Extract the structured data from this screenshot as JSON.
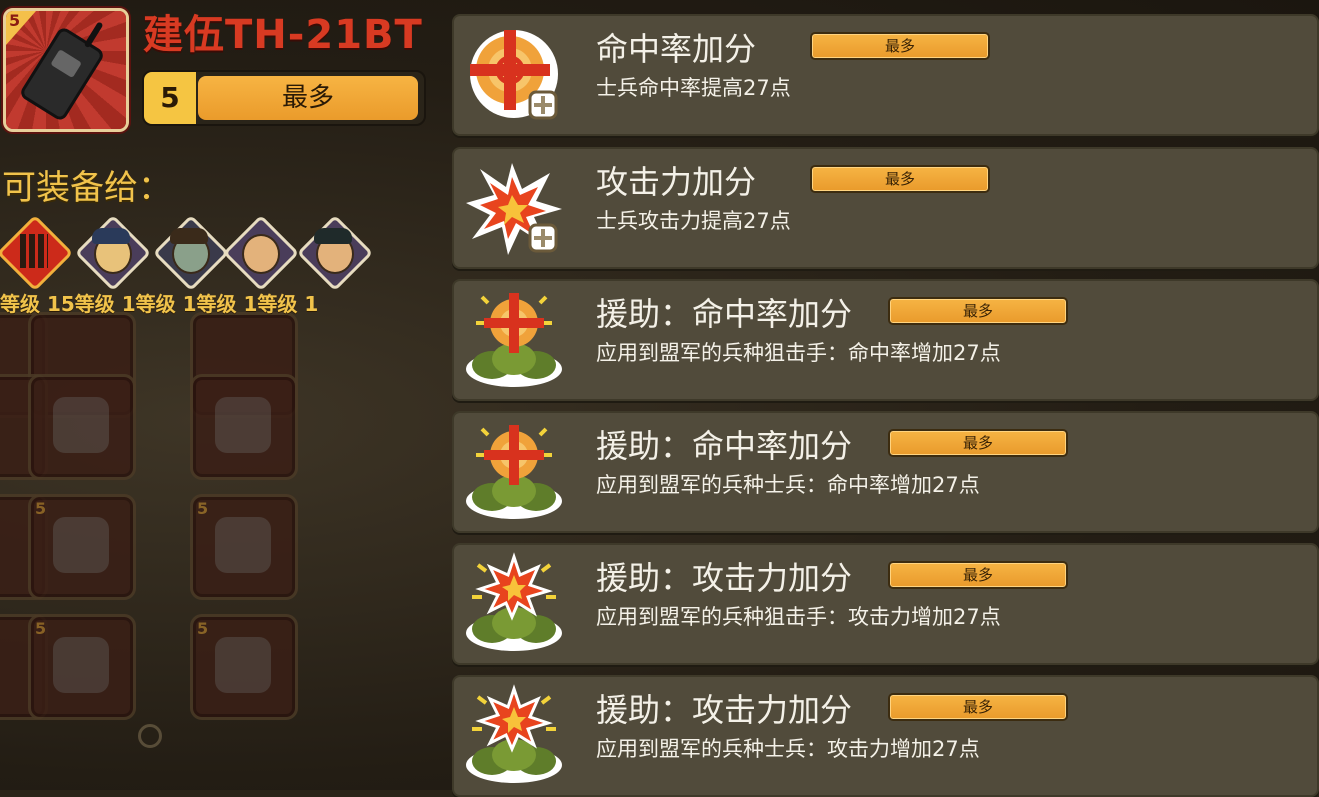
{
  "item": {
    "level": "5",
    "name": "建伍TH-21BT",
    "level_bar_number": "5",
    "level_bar_label": "最多",
    "level_fill_fraction": 1.0
  },
  "equip": {
    "label": "可装备给：",
    "units": [
      {
        "icon": "ammo-icon",
        "level_text": "等级 15"
      },
      {
        "icon": "blonde-soldier-icon",
        "level_text": "等级 1"
      },
      {
        "icon": "gasmask-soldier-icon",
        "level_text": "等级 1"
      },
      {
        "icon": "bald-soldier-icon",
        "level_text": "等级 1"
      },
      {
        "icon": "mustache-soldier-icon",
        "level_text": "等级 1"
      }
    ],
    "unit_level_line": "等级 15等级 1等级 1等级 1等级 1"
  },
  "perks": [
    {
      "icon": "crosshair-plus-icon",
      "title": "命中率加分",
      "max_label": "最多",
      "desc": "士兵命中率提高27点"
    },
    {
      "icon": "explosion-plus-icon",
      "title": "攻击力加分",
      "max_label": "最多",
      "desc": "士兵攻击力提高27点"
    },
    {
      "icon": "support-crosshair-icon",
      "title": "援助：命中率加分",
      "max_label": "最多",
      "desc": "应用到盟军的兵种狙击手：命中率增加27点"
    },
    {
      "icon": "support-crosshair-icon",
      "title": "援助：命中率加分",
      "max_label": "最多",
      "desc": "应用到盟军的兵种士兵：命中率增加27点"
    },
    {
      "icon": "support-explosion-icon",
      "title": "援助：攻击力加分",
      "max_label": "最多",
      "desc": "应用到盟军的兵种狙击手：攻击力增加27点"
    },
    {
      "icon": "support-explosion-icon",
      "title": "援助：攻击力加分",
      "max_label": "最多",
      "desc": "应用到盟军的兵种士兵：攻击力增加27点"
    }
  ],
  "colors": {
    "panel_bg": "#514b3b",
    "max_bar": "#f0a535",
    "title_red": "#d83a22",
    "gold": "#f1c34b"
  }
}
